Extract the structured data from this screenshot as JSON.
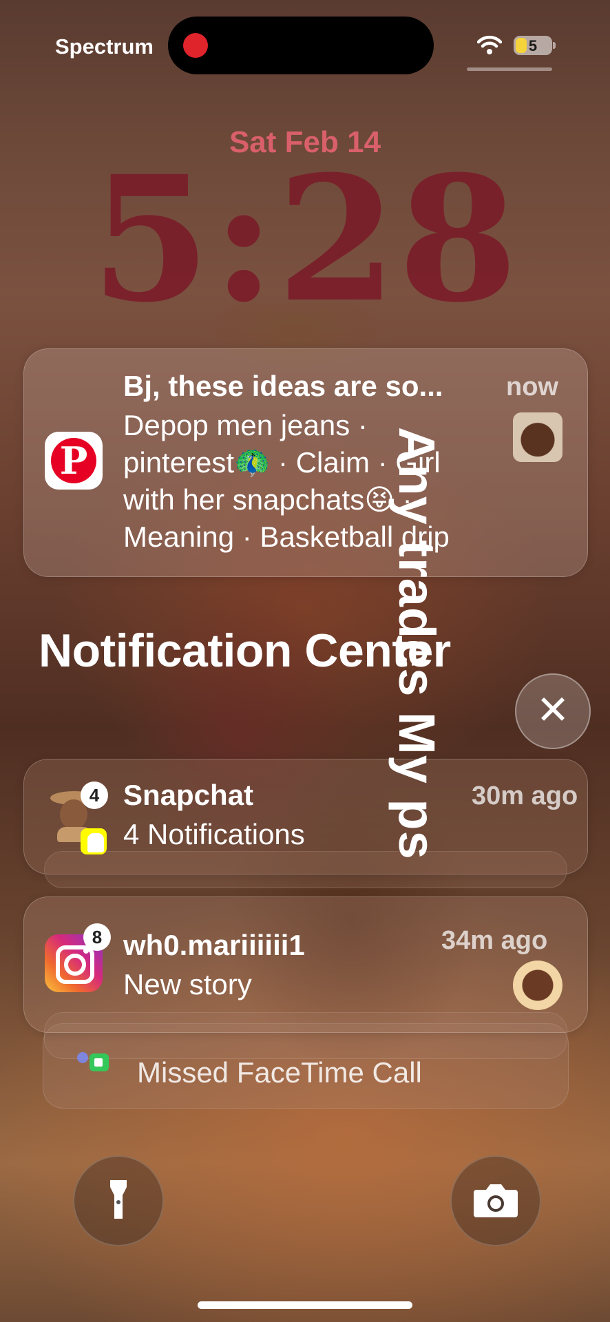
{
  "status_bar": {
    "carrier": "Spectrum",
    "battery": "5",
    "recording": true
  },
  "lock_screen": {
    "date": "Sat Feb 14",
    "time": "5:28"
  },
  "notifications": {
    "pinterest": {
      "app": "Pinterest",
      "title": "Bj, these ideas are so...",
      "time": "now",
      "body_line1": "Depop men jeans ·",
      "body_line2": "pinterest🦚 · Claim · Girl",
      "body_line3": "with her snapchats😝 ·",
      "body_line4": "Meaning · Basketball drip"
    },
    "heading": "Notification Center",
    "snapchat": {
      "app": "Snapchat",
      "badge": "4",
      "title": "Snapchat",
      "body": "4 Notifications",
      "time": "30m ago"
    },
    "instagram": {
      "app": "Instagram",
      "badge": "8",
      "title": "wh0.mariiiiii1",
      "body": "New story",
      "time": "34m ago"
    },
    "facetime": {
      "body": "Missed FaceTime Call"
    }
  },
  "overlay_caption": "Any trades My ps",
  "colors": {
    "date": "#d9606a",
    "clock": "#7a1f2a",
    "record": "#e0242c",
    "pinterest": "#e60023",
    "snapchat": "#fffc00"
  },
  "icons": [
    "wifi-icon",
    "battery-icon",
    "pinterest-icon",
    "snapchat-icon",
    "instagram-icon",
    "facetime-icon",
    "close-icon",
    "flashlight-icon",
    "camera-icon"
  ]
}
